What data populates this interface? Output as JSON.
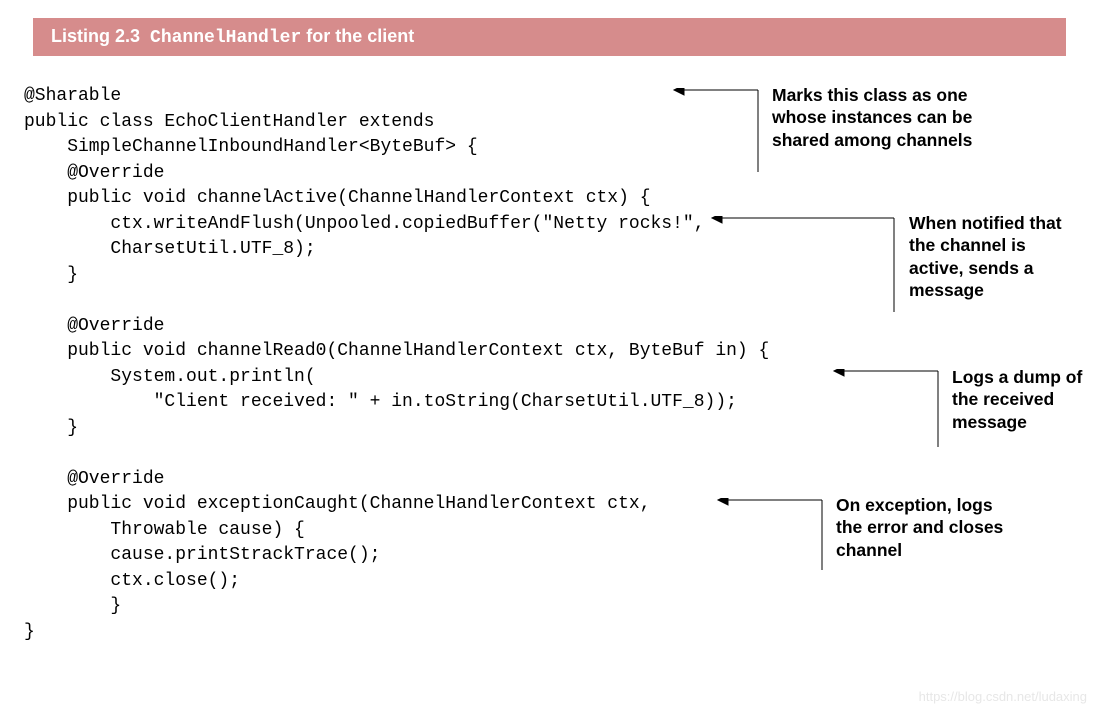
{
  "header": {
    "prefix": "Listing 2.3",
    "code": "ChannelHandler",
    "suffix": " for the client"
  },
  "code": {
    "l1": "@Sharable",
    "l2": "public class EchoClientHandler extends",
    "l3": "    SimpleChannelInboundHandler<ByteBuf> {",
    "l4": "    @Override",
    "l5": "    public void channelActive(ChannelHandlerContext ctx) {",
    "l6": "        ctx.writeAndFlush(Unpooled.copiedBuffer(\"Netty rocks!\",",
    "l7": "        CharsetUtil.UTF_8);",
    "l8": "    }",
    "l9": "",
    "l10": "    @Override",
    "l11": "    public void channelRead0(ChannelHandlerContext ctx, ByteBuf in) {",
    "l12": "        System.out.println(",
    "l13": "            \"Client received: \" + in.toString(CharsetUtil.UTF_8));",
    "l14": "    }",
    "l15": "",
    "l16": "    @Override",
    "l17": "    public void exceptionCaught(ChannelHandlerContext ctx,",
    "l18": "        Throwable cause) {",
    "l19": "        cause.printStrackTrace();",
    "l20": "        ctx.close();",
    "l21": "        }",
    "l22": "}"
  },
  "annotations": {
    "a1": "Marks this class as one whose instances can be shared among channels",
    "a2": "When notified that the channel is active, sends a message",
    "a3": "Logs a dump of the received message",
    "a4": "On exception, logs the error and closes channel"
  },
  "watermark": "https://blog.csdn.net/ludaxing"
}
